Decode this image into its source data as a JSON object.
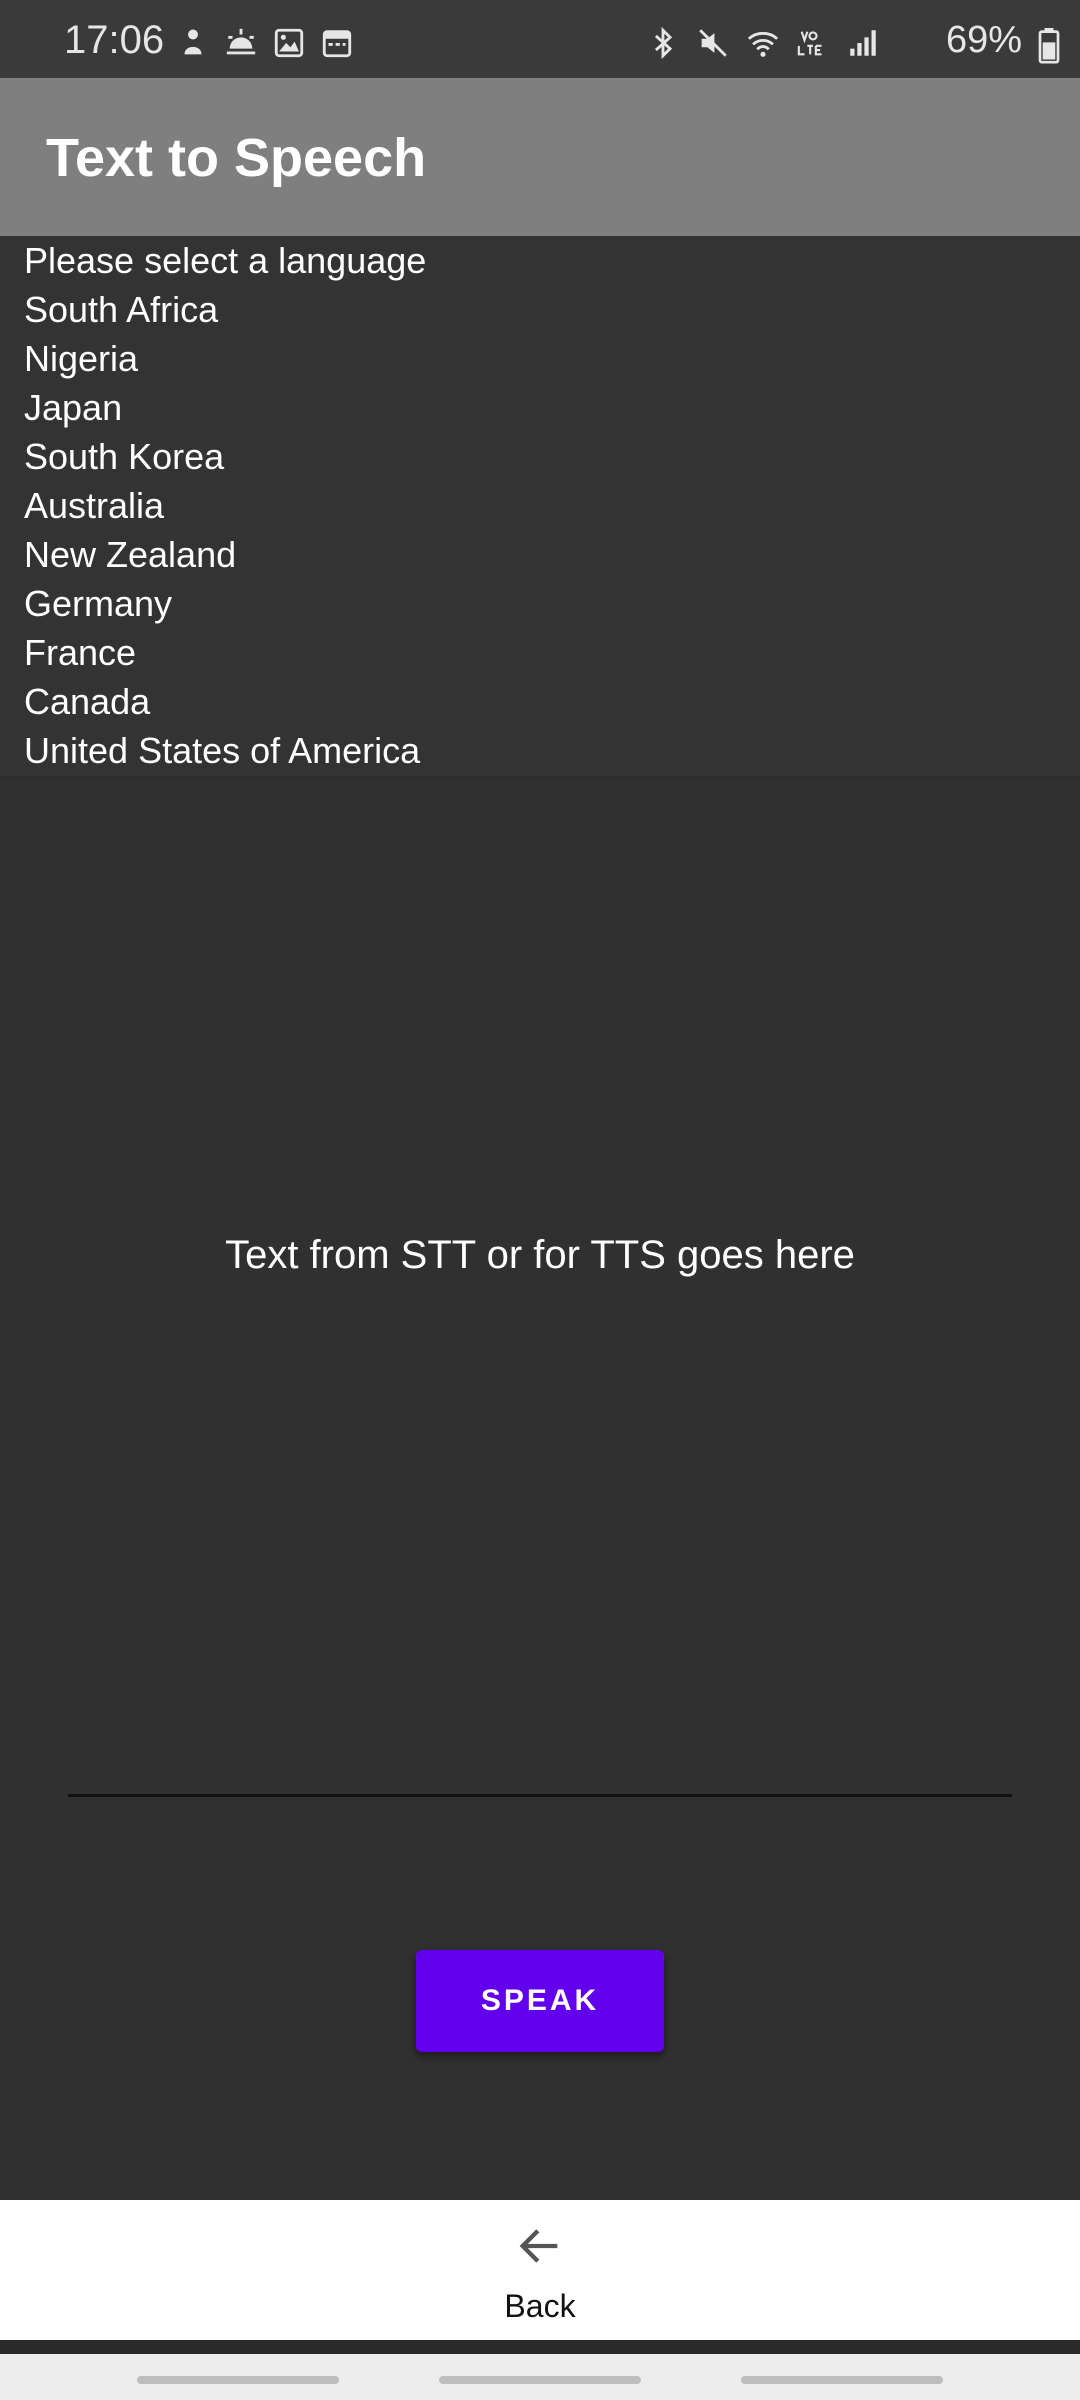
{
  "status_bar": {
    "time": "17:06",
    "battery": "69%",
    "left_icons": [
      "notification-person-icon",
      "weather-icon",
      "gallery-icon",
      "calendar-icon"
    ],
    "right_icons": [
      "bluetooth-icon",
      "mute-icon",
      "wifi-icon",
      "volte-icon",
      "signal-icon"
    ]
  },
  "app_bar": {
    "title": "Text to Speech"
  },
  "languages": {
    "items": [
      "Please select a language",
      "South Africa",
      "Nigeria",
      "Japan",
      "South Korea",
      "Australia",
      "New Zealand",
      "Germany",
      "France",
      "Canada",
      "United States of America"
    ]
  },
  "main": {
    "text": "Text from STT or for TTS goes here",
    "speak_label": "SPEAK"
  },
  "bottom": {
    "back_label": "Back"
  },
  "colors": {
    "background": "#303030",
    "app_bar": "#7f7f7f",
    "accent": "#6200ee"
  }
}
